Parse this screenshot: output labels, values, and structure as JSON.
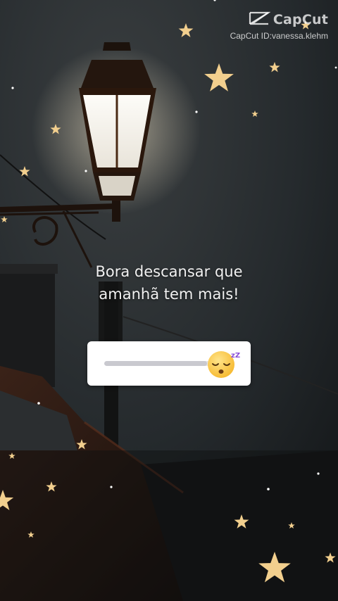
{
  "watermark": {
    "app_name": "CapCut",
    "id_text": "CapCut ID:vanessa.klehm",
    "logo_icon": "capcut-logo-icon"
  },
  "caption": {
    "line1": "Bora descansar que",
    "line2": "amanhã tem mais!"
  },
  "emoji_slider": {
    "emoji": "sleeping-face-emoji",
    "level": 0.86,
    "sleep_letters": "zZ"
  },
  "colors": {
    "star": "#f2cf8e",
    "lamp_glow": "#fff1d6",
    "card": "#ffffff"
  }
}
